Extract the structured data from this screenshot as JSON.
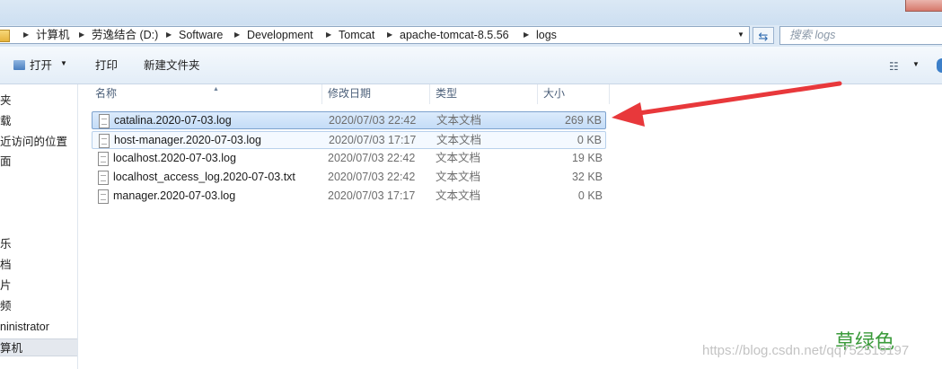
{
  "address": {
    "crumbs": [
      "计算机",
      "劳逸结合 (D:)",
      "Software",
      "Development",
      "Tomcat",
      "apache-tomcat-8.5.56",
      "logs"
    ],
    "search_placeholder": "搜索 logs"
  },
  "toolbar": {
    "open_label": "打开",
    "print_label": "打印",
    "new_folder_label": "新建文件夹"
  },
  "nav": {
    "items": [
      "夹",
      "载",
      "近访问的位置",
      "面",
      "乐",
      "档",
      "片",
      "频",
      "ninistrator",
      "算机"
    ]
  },
  "columns": {
    "name": "名称",
    "date": "修改日期",
    "type": "类型",
    "size": "大小"
  },
  "files": [
    {
      "name": "catalina.2020-07-03.log",
      "date": "2020/07/03 22:42",
      "type": "文本文档",
      "size": "269 KB"
    },
    {
      "name": "host-manager.2020-07-03.log",
      "date": "2020/07/03 17:17",
      "type": "文本文档",
      "size": "0 KB"
    },
    {
      "name": "localhost.2020-07-03.log",
      "date": "2020/07/03 22:42",
      "type": "文本文档",
      "size": "19 KB"
    },
    {
      "name": "localhost_access_log.2020-07-03.txt",
      "date": "2020/07/03 22:42",
      "type": "文本文档",
      "size": "32 KB"
    },
    {
      "name": "manager.2020-07-03.log",
      "date": "2020/07/03 17:17",
      "type": "文本文档",
      "size": "0 KB"
    }
  ],
  "watermark": {
    "url": "https://blog.csdn.net/qq752519197",
    "text": "草绿色"
  },
  "colors": {
    "annotation_arrow": "#e8383b",
    "selection_border": "#7da2ce"
  }
}
